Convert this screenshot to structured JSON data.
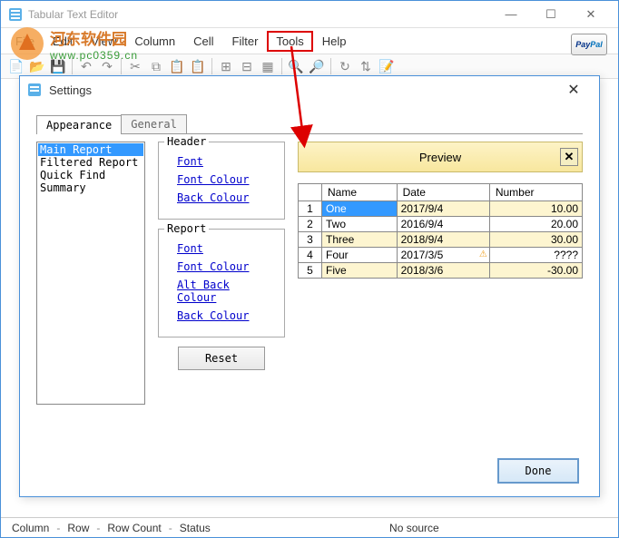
{
  "main": {
    "title": "Tabular Text Editor",
    "menubar": [
      "File",
      "Edit",
      "View",
      "Column",
      "Cell",
      "Filter",
      "Tools",
      "Help"
    ],
    "highlighted_menu_index": 6,
    "paypal": "PayPal"
  },
  "watermark": {
    "cn": "河东软件园",
    "url": "www.pc0359.cn"
  },
  "toolbar_icons": [
    "new-icon",
    "open-icon",
    "save-icon",
    "sep",
    "undo-icon",
    "redo-icon",
    "sep",
    "cut-icon",
    "copy-icon",
    "paste-icon",
    "paste2-icon",
    "sep",
    "rowins-icon",
    "rowdel-icon",
    "colins-icon",
    "sep",
    "zoomin-icon",
    "zoomout-icon",
    "sep",
    "refresh-icon",
    "sort-icon",
    "script-icon"
  ],
  "settings": {
    "title": "Settings",
    "tabs": [
      "Appearance",
      "General"
    ],
    "active_tab": 0,
    "list_items": [
      "Main Report",
      "Filtered Report",
      "Quick Find",
      "Summary"
    ],
    "selected_list_index": 0,
    "header_group": "Header",
    "report_group": "Report",
    "header_links": [
      "Font",
      "Font Colour",
      "Back Colour"
    ],
    "report_links": [
      "Font",
      "Font Colour",
      "Alt Back Colour",
      "Back Colour"
    ],
    "reset_label": "Reset",
    "preview_label": "Preview",
    "done_label": "Done",
    "table": {
      "headers": [
        "",
        "Name",
        "Date",
        "Number"
      ],
      "rows": [
        {
          "n": "1",
          "name": "One",
          "date": "2017/9/4",
          "number": "10.00",
          "sel": true
        },
        {
          "n": "2",
          "name": "Two",
          "date": "2016/9/4",
          "number": "20.00"
        },
        {
          "n": "3",
          "name": "Three",
          "date": "2018/9/4",
          "number": "30.00",
          "alt": true
        },
        {
          "n": "4",
          "name": "Four",
          "date": "2017/3/5",
          "number": "????",
          "warn": true
        },
        {
          "n": "5",
          "name": "Five",
          "date": "2018/3/6",
          "number": "-30.00",
          "alt": true
        }
      ]
    }
  },
  "statusbar": {
    "column": "Column",
    "row": "Row",
    "rowcount": "Row Count",
    "status": "Status",
    "source": "No source",
    "dash": "-"
  }
}
